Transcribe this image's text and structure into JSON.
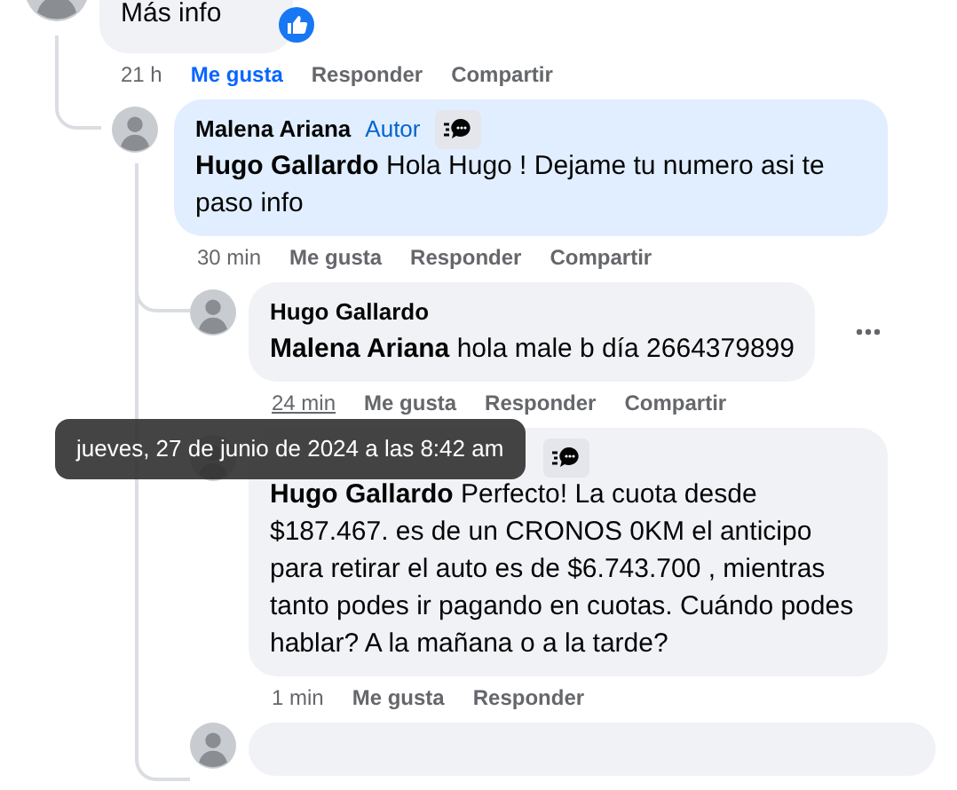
{
  "top_comment": {
    "text": "Más info",
    "liked_reaction": true,
    "time": "21 h",
    "actions": [
      {
        "label": "Me gusta",
        "selected": true
      },
      {
        "label": "Responder",
        "selected": false
      },
      {
        "label": "Compartir",
        "selected": false
      }
    ]
  },
  "replies": [
    {
      "kind": "comment",
      "author": "Malena Ariana",
      "badge": "Autor",
      "chat_badge": true,
      "highlighted": true,
      "text": "**Hugo Gallardo** Hola Hugo ! Dejame tu numero asi te paso info",
      "time": "30 min",
      "time_hovered": false,
      "more_menu": false,
      "actions": [
        {
          "label": "Me gusta",
          "selected": false
        },
        {
          "label": "Responder",
          "selected": false
        },
        {
          "label": "Compartir",
          "selected": false
        }
      ]
    },
    {
      "kind": "comment",
      "author": "Hugo Gallardo",
      "chat_badge": false,
      "highlighted": false,
      "text": "**Malena Ariana** hola male b día 2664379899",
      "time": "24 min",
      "time_hovered": true,
      "more_menu": true,
      "actions": [
        {
          "label": "Me gusta",
          "selected": false
        },
        {
          "label": "Responder",
          "selected": false
        },
        {
          "label": "Compartir",
          "selected": false
        }
      ]
    },
    {
      "kind": "comment",
      "chat_badge": true,
      "highlighted": false,
      "text": "**Hugo Gallardo** Perfecto! La cuota desde $187.467. es de un CRONOS 0KM el anticipo para retirar el auto es de $6.743.700 , mientras tanto podes ir pagando en cuotas. Cuándo podes hablar? A la mañana o a la tarde?",
      "time": "1 min",
      "time_hovered": false,
      "more_menu": false,
      "actions": [
        {
          "label": "Me gusta",
          "selected": false
        },
        {
          "label": "Responder",
          "selected": false
        }
      ]
    },
    {
      "kind": "cut_off"
    }
  ],
  "tooltip": {
    "text": "jueves, 27 de junio de 2024 a las 8:42 am"
  }
}
